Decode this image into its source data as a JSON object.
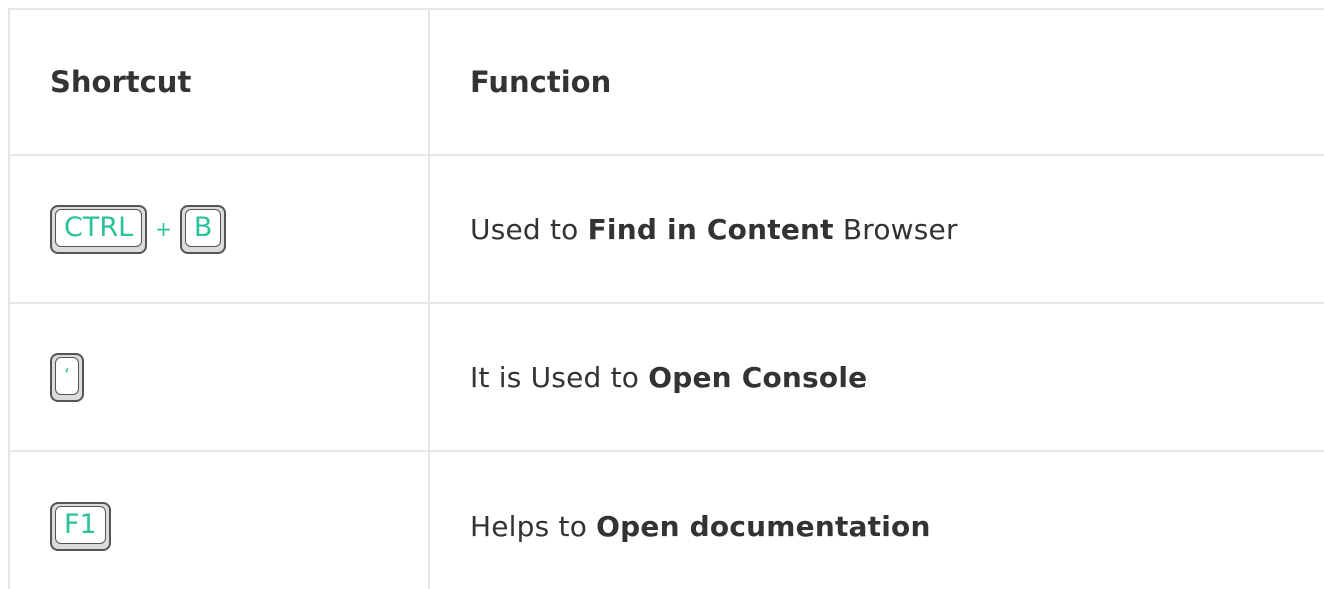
{
  "table": {
    "headers": {
      "shortcut": "Shortcut",
      "function": "Function"
    },
    "rows": [
      {
        "keys": [
          "CTRL",
          "B"
        ],
        "separator": "+",
        "function_prefix": "Used to ",
        "function_bold": "Find in Content",
        "function_suffix": " Browser"
      },
      {
        "keys": [
          "‘"
        ],
        "function_prefix": "It is Used to ",
        "function_bold": "Open Console",
        "function_suffix": ""
      },
      {
        "keys": [
          "F1"
        ],
        "function_prefix": "Helps to ",
        "function_bold": "Open documentation",
        "function_suffix": ""
      }
    ]
  },
  "colors": {
    "key_text": "#2bc29a",
    "text": "#333333",
    "border": "#e6e6e6"
  }
}
